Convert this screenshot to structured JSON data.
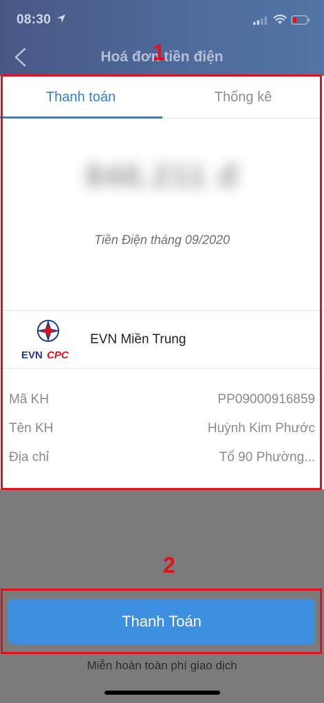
{
  "status_bar": {
    "time": "08:30"
  },
  "header": {
    "title": "Hoá đơn tiền điện"
  },
  "tabs": [
    {
      "label": "Thanh toán",
      "active": true
    },
    {
      "label": "Thống kê",
      "active": false
    }
  ],
  "bill": {
    "amount": "846.211 đ",
    "period": "Tiền Điện tháng 09/2020"
  },
  "provider": {
    "name": "EVN Miền Trung",
    "logo_text_evn": "EVN",
    "logo_text_cpc": "CPC"
  },
  "info": [
    {
      "label": "Mã KH",
      "value": "PP09000916859"
    },
    {
      "label": "Tên KH",
      "value": "Huỳnh Kim Phước"
    },
    {
      "label": "Địa chỉ",
      "value": "Tổ 90 Phường..."
    }
  ],
  "annotations": {
    "first": "1",
    "second": "2"
  },
  "actions": {
    "pay_label": "Thanh Toán",
    "fee_note": "Miễn hoàn toàn phí giao dịch"
  },
  "colors": {
    "accent": "#2f7fd4",
    "button": "#3d8fe0",
    "annotation": "#e3101c"
  }
}
